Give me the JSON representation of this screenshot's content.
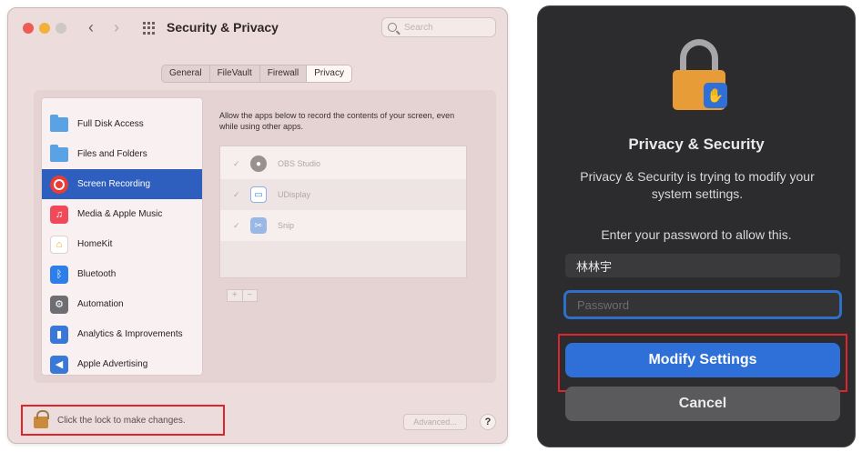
{
  "left_window": {
    "title": "Security & Privacy",
    "search_placeholder": "Search",
    "tabs": [
      {
        "label": "General"
      },
      {
        "label": "FileVault"
      },
      {
        "label": "Firewall"
      },
      {
        "label": "Privacy",
        "active": true
      }
    ],
    "sidebar": [
      {
        "label": "Full Disk Access",
        "icon": "folder-icon"
      },
      {
        "label": "Files and Folders",
        "icon": "folder-icon"
      },
      {
        "label": "Screen Recording",
        "icon": "screen-recording-icon",
        "selected": true
      },
      {
        "label": "Media & Apple Music",
        "icon": "music-icon"
      },
      {
        "label": "HomeKit",
        "icon": "home-icon"
      },
      {
        "label": "Bluetooth",
        "icon": "bluetooth-icon"
      },
      {
        "label": "Automation",
        "icon": "gear-icon"
      },
      {
        "label": "Analytics & Improvements",
        "icon": "analytics-icon"
      },
      {
        "label": "Apple Advertising",
        "icon": "megaphone-icon"
      }
    ],
    "description": "Allow the apps below to record the contents of your screen, even while using other apps.",
    "apps": [
      {
        "name": "OBS Studio",
        "checked": true,
        "icon": "obs-icon"
      },
      {
        "name": "UDisplay",
        "checked": true,
        "icon": "udisplay-icon"
      },
      {
        "name": "Snip",
        "checked": true,
        "icon": "snip-icon"
      }
    ],
    "add_label": "+",
    "remove_label": "−",
    "lock_text": "Click the lock to make changes.",
    "advanced_label": "Advanced...",
    "help_label": "?"
  },
  "right_dialog": {
    "title": "Privacy & Security",
    "message": "Privacy & Security is trying to modify your system settings.",
    "prompt": "Enter your password to allow this.",
    "username": "林林宇",
    "password_placeholder": "Password",
    "modify_label": "Modify Settings",
    "cancel_label": "Cancel"
  },
  "colors": {
    "selection_blue": "#2e5fbf",
    "highlight_red": "#e0242b",
    "dialog_bg": "#2c2b2e",
    "primary_button": "#2f6fd8"
  }
}
